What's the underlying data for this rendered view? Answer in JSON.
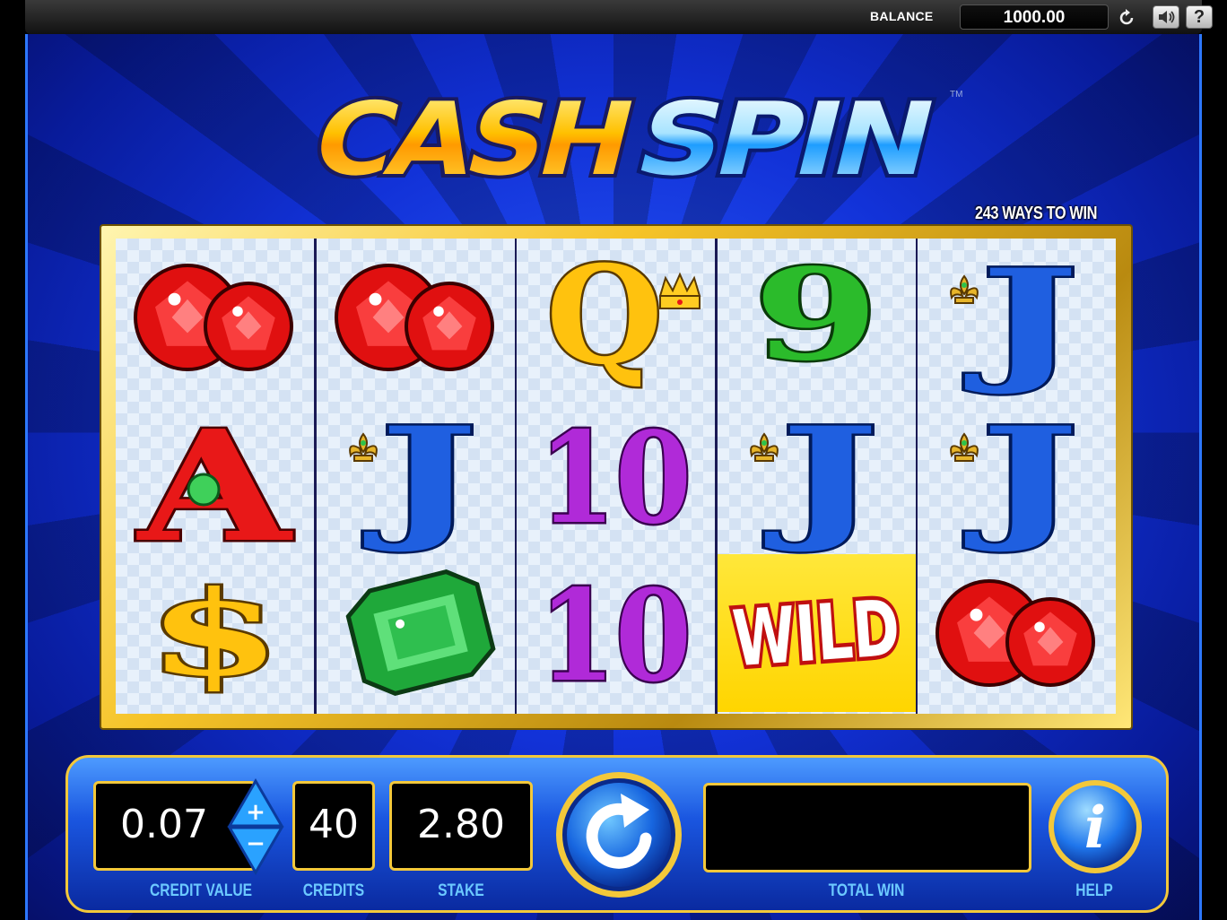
{
  "top_bar": {
    "balance_label": "BALANCE",
    "balance_value": "1000.00",
    "help_label": "?"
  },
  "game": {
    "logo_word1": "CASH",
    "logo_word2": "SPIN",
    "logo_tm": "TM",
    "ways_label": "243 WAYS TO WIN",
    "reels": [
      [
        "rubies",
        "ace",
        "dollar"
      ],
      [
        "rubies",
        "jack",
        "emerald"
      ],
      [
        "queen",
        "ten",
        "ten"
      ],
      [
        "nine",
        "jack",
        "wild"
      ],
      [
        "jack",
        "jack",
        "rubies"
      ]
    ],
    "wild_text": "WILD"
  },
  "panel": {
    "credit_value": "0.07",
    "credit_value_label": "CREDIT VALUE",
    "credits": "40",
    "credits_label": "CREDITS",
    "stake": "2.80",
    "stake_label": "STAKE",
    "total_win": "",
    "total_win_label": "TOTAL WIN",
    "help_label": "HELP",
    "help_glyph": "i",
    "plus": "+",
    "minus": "−"
  },
  "colors": {
    "gold": "#f3c83a",
    "label_blue": "#6cc9ff",
    "ruby": "#e01010",
    "emerald": "#1fa83a",
    "jack_blue": "#1f5fe0",
    "ten_purple": "#b02ad8"
  }
}
